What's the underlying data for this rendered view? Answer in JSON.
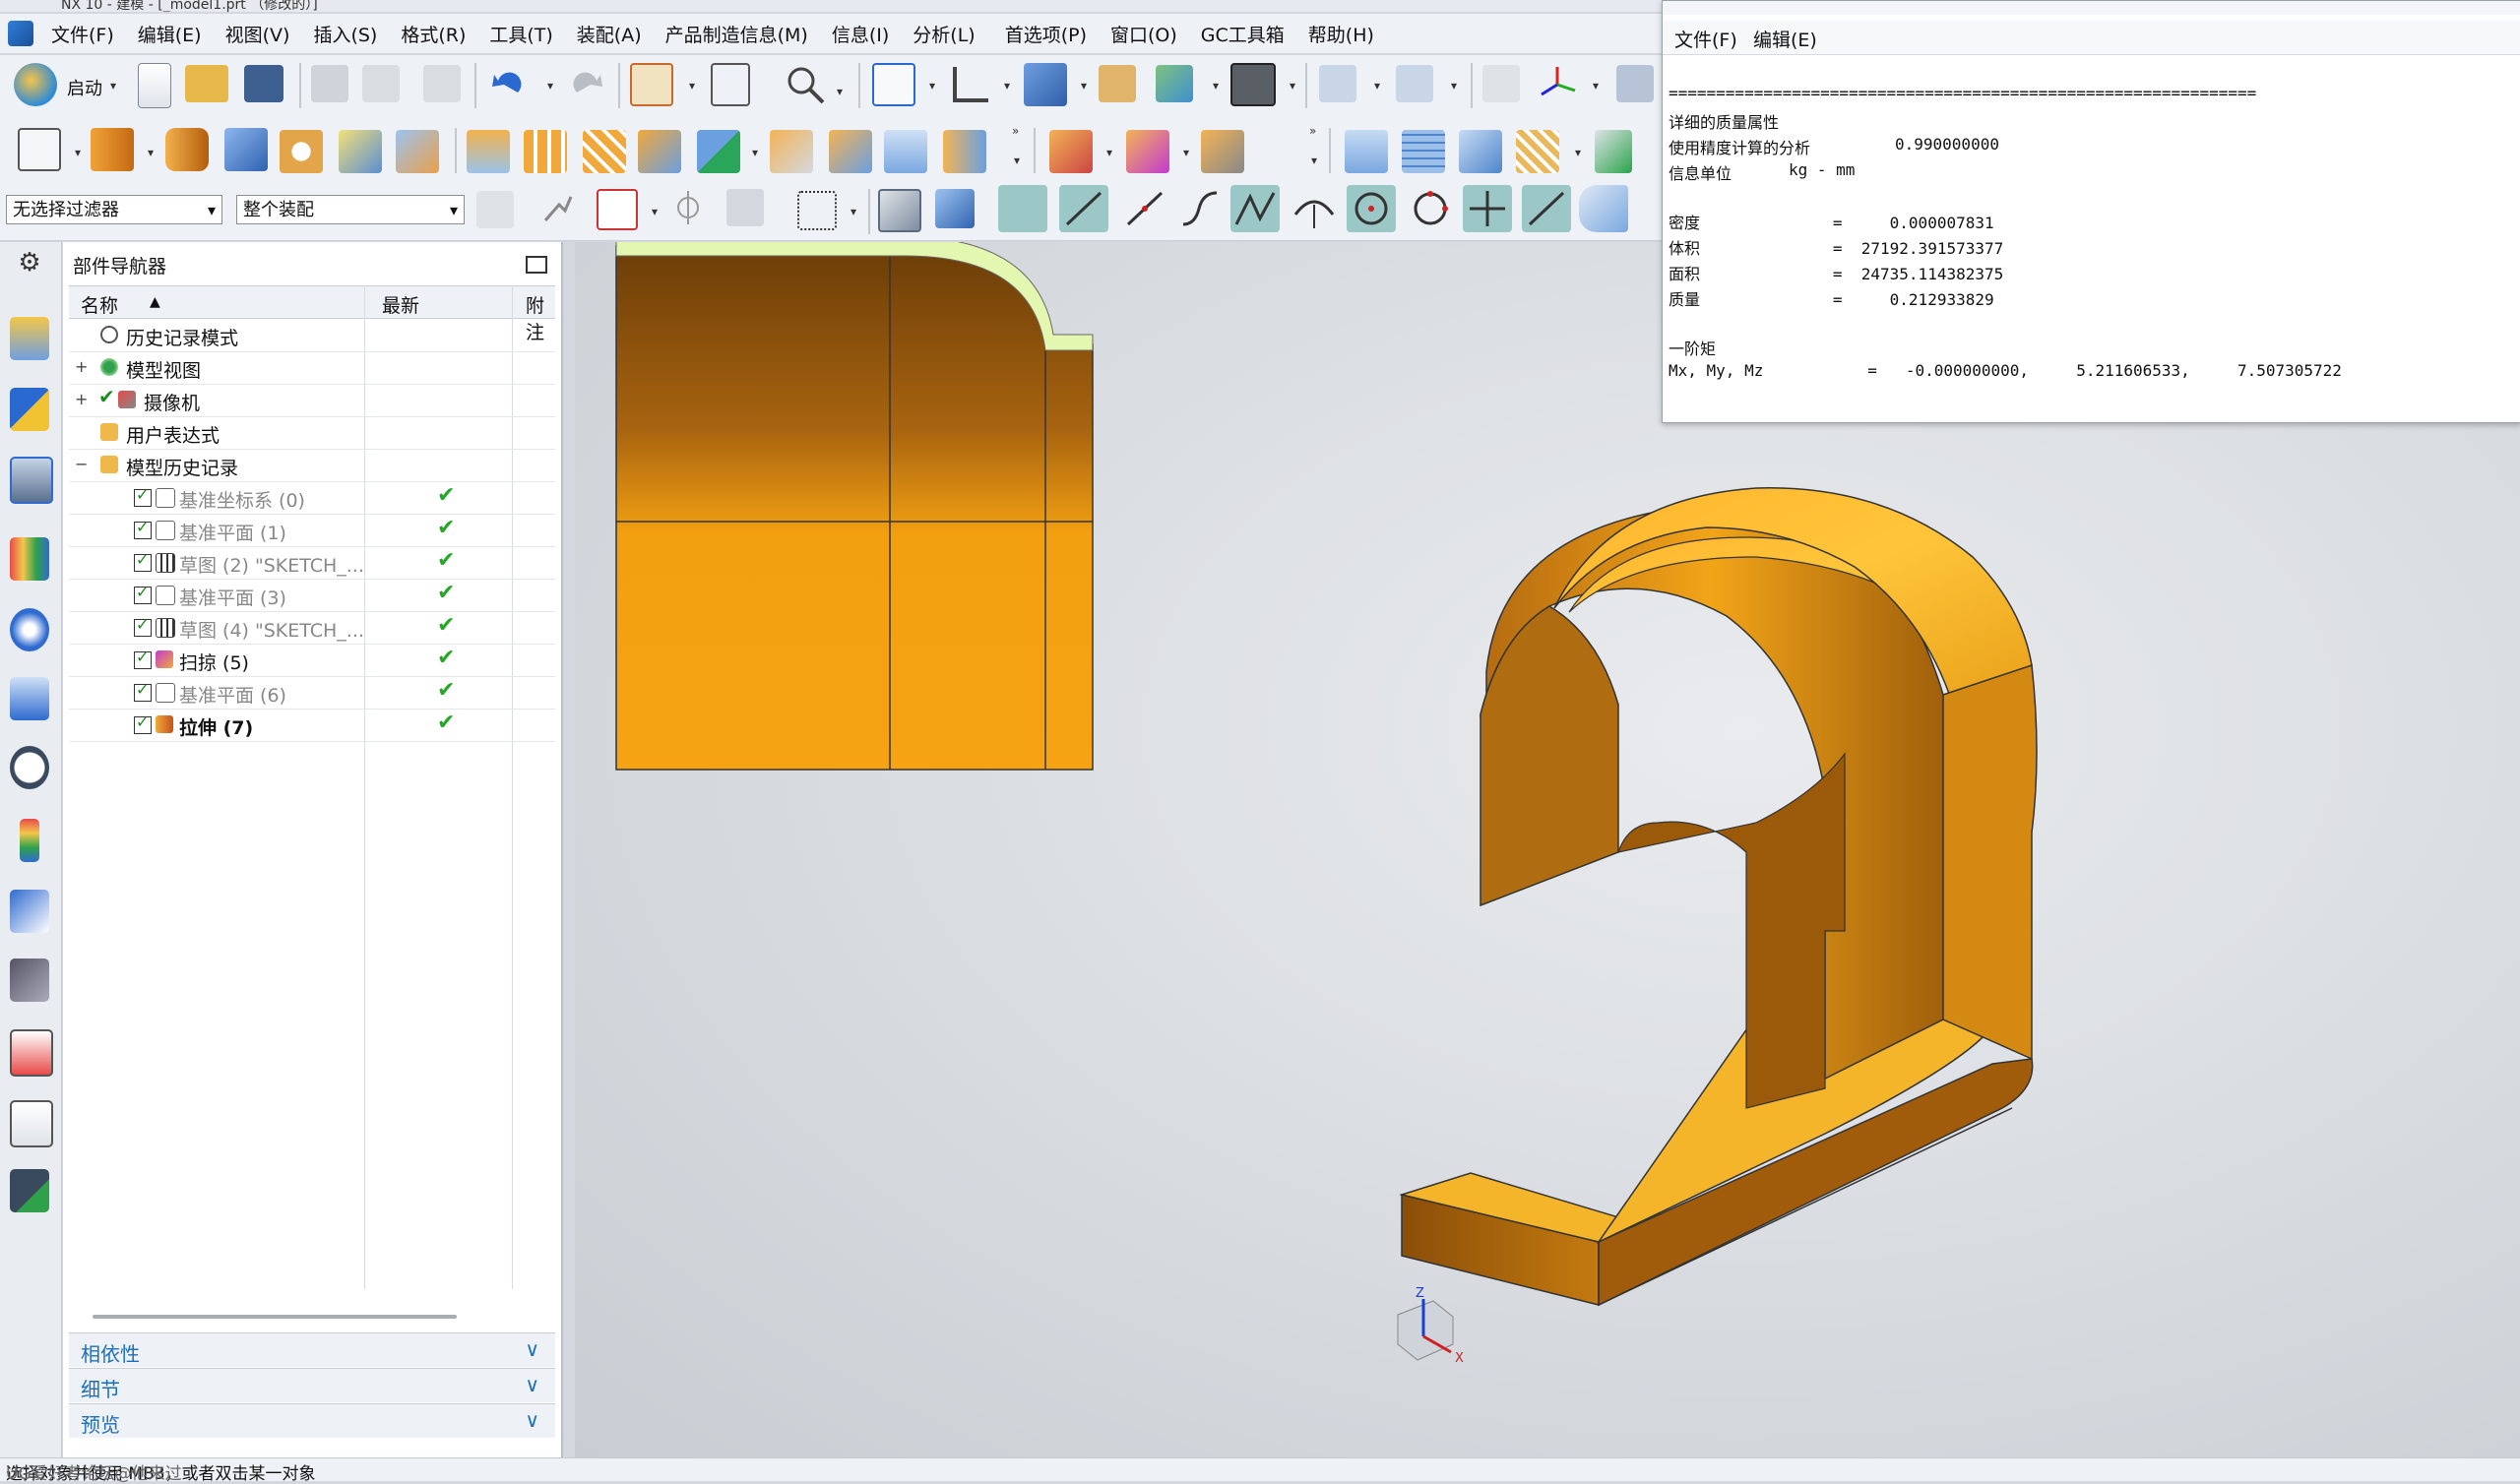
{
  "app": {
    "title_fragment": "NX 10 - 建模 - [_model1.prt （修改的）]"
  },
  "menubar": {
    "items": [
      "文件(F)",
      "编辑(E)",
      "视图(V)",
      "插入(S)",
      "格式(R)",
      "工具(T)",
      "装配(A)",
      "产品制造信息(M)",
      "信息(I)",
      "分析(L)",
      "首选项(P)",
      "窗口(O)",
      "GC工具箱",
      "帮助(H)"
    ]
  },
  "toolbar": {
    "start_label": "启动",
    "filter_select": "无选择过滤器",
    "assembly_select": "整个装配"
  },
  "navigator": {
    "title": "部件导航器",
    "col_name": "名称",
    "col_latest": "最新",
    "col_note": "附注",
    "items": [
      {
        "label": "历史记录模式"
      },
      {
        "label": "模型视图"
      },
      {
        "label": "摄像机"
      },
      {
        "label": "用户表达式"
      },
      {
        "label": "模型历史记录"
      },
      {
        "label": "基准坐标系 (0)",
        "latest": "✔"
      },
      {
        "label": "基准平面 (1)",
        "latest": "✔"
      },
      {
        "label": "草图 (2) \"SKETCH_...",
        "latest": "✔"
      },
      {
        "label": "基准平面 (3)",
        "latest": "✔"
      },
      {
        "label": "草图 (4) \"SKETCH_...",
        "latest": "✔"
      },
      {
        "label": "扫掠 (5)",
        "latest": "✔"
      },
      {
        "label": "基准平面 (6)",
        "latest": "✔"
      },
      {
        "label": "拉伸 (7)",
        "latest": "✔"
      }
    ],
    "panels": [
      "相依性",
      "细节",
      "预览"
    ]
  },
  "info_window": {
    "menu": [
      "文件(F)",
      "编辑(E)"
    ],
    "rule": "==============================================================",
    "heading": "详细的质量属性",
    "precision_label": "使用精度计算的分析",
    "precision_value": "0.990000000",
    "units_label": "信息单位",
    "units_value": "kg - mm",
    "density": "密度              =     0.000007831",
    "volume": "体积              =  27192.391573377",
    "area": "面积              =  24735.114382375",
    "mass": "质量              =     0.212933829",
    "first_moment_heading": "一阶矩",
    "moments": "Mx, My, Mz           =   -0.000000000,     5.211606533,     7.507305722"
  },
  "triad": {
    "z": "Z",
    "x": "X"
  },
  "status": {
    "prompt": "选择对象并使用 MB3，或者双击某一对象",
    "watermark": "UG爱好者论坛@他来过"
  }
}
